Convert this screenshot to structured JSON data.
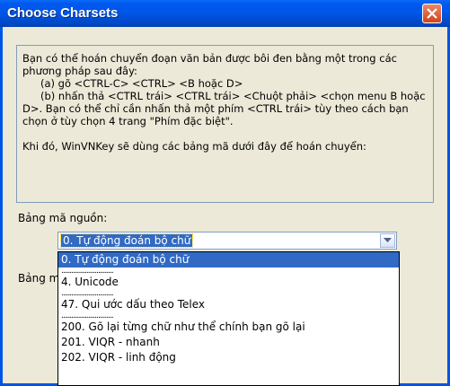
{
  "window": {
    "title": "Choose Charsets"
  },
  "info": {
    "line1": "Bạn có thể hoán chuyển đoạn văn bản được bôi đen bằng một trong các",
    "line2": "phương pháp sau đây:",
    "line3": "(a) gõ <CTRL-C> <CTRL> <B hoặc D>",
    "line4": "(b) nhấn thả <CTRL trái> <CTRL trái> <Chuột phải> <chọn menu B hoặc",
    "line5": "D>.   Bạn có thể chỉ cần nhấn thả một phím <CTRL trái> tùy theo cách bạn",
    "line6": "chọn ở tùy chọn 4 trang \"Phím đặc biệt\".",
    "line7": "Khi đó, WinVNKey sẽ dùng các bảng mã dưới đây để hoán chuyển:"
  },
  "source": {
    "label": "Bảng mã nguồn:",
    "selected": "0. Tự động đoán bộ chữ"
  },
  "target": {
    "label_partial": "Bảng m"
  },
  "dropdown": {
    "items": [
      {
        "text": "0. Tự động đoán bộ chữ",
        "highlighted": true
      },
      {
        "separator": "..............................."
      },
      {
        "text": "4. Unicode"
      },
      {
        "separator": "..............................."
      },
      {
        "text": "47. Qui ước dấu theo Telex"
      },
      {
        "separator": "..............................."
      },
      {
        "text": "200.  Gõ lại từng chữ như thể chính bạn gõ lại"
      },
      {
        "text": "201.  VIQR - nhanh"
      },
      {
        "text": "202.  VIQR - linh động"
      }
    ]
  },
  "colors": {
    "titlebar": "#0055E5",
    "selection": "#316AC5",
    "dialog_bg": "#ECE9D8"
  }
}
